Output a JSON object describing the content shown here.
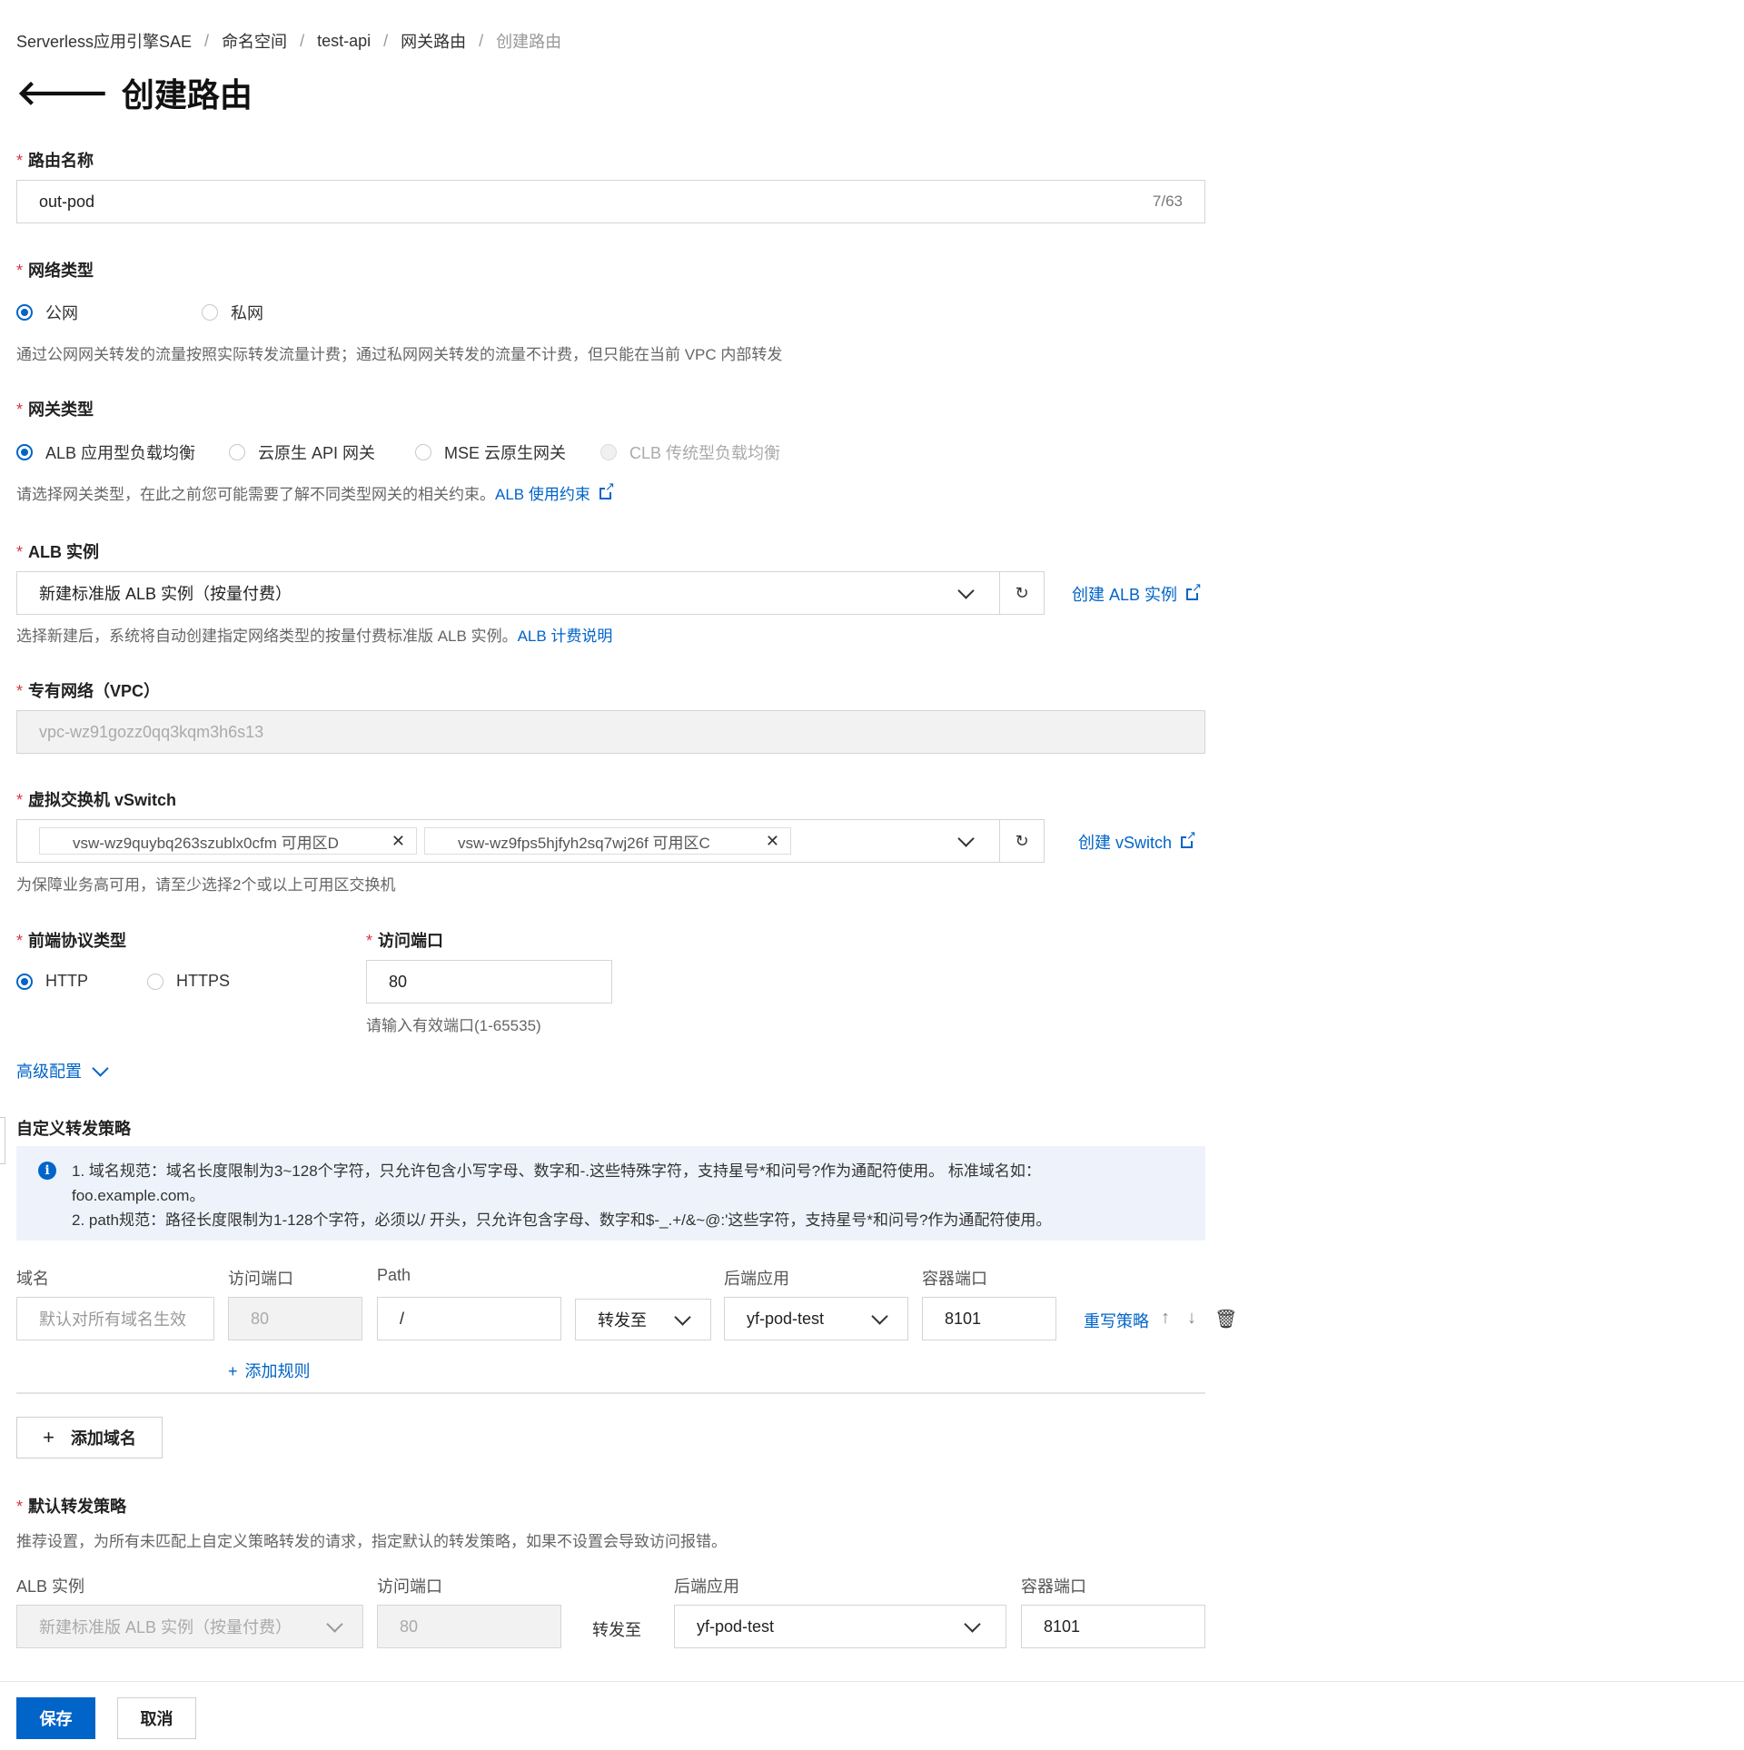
{
  "breadcrumb": [
    "Serverless应用引擎SAE",
    "命名空间",
    "test-api",
    "网关路由",
    "创建路由"
  ],
  "page_title": "创建路由",
  "route_name": {
    "label": "路由名称",
    "value": "out-pod",
    "counter": "7/63"
  },
  "network_type": {
    "label": "网络类型",
    "options": [
      "公网",
      "私网"
    ],
    "selected": "公网",
    "help": "通过公网网关转发的流量按照实际转发流量计费；通过私网网关转发的流量不计费，但只能在当前 VPC 内部转发"
  },
  "gateway_type": {
    "label": "网关类型",
    "options": [
      "ALB 应用型负载均衡",
      "云原生 API 网关",
      "MSE 云原生网关",
      "CLB 传统型负载均衡"
    ],
    "selected": "ALB 应用型负载均衡",
    "help": "请选择网关类型，在此之前您可能需要了解不同类型网关的相关约束。",
    "help_link": "ALB 使用约束"
  },
  "alb_instance": {
    "label": "ALB 实例",
    "value": "新建标准版 ALB 实例（按量付费）",
    "create_link": "创建 ALB 实例",
    "help": "选择新建后，系统将自动创建指定网络类型的按量付费标准版 ALB 实例。",
    "help_link": "ALB 计费说明"
  },
  "vpc": {
    "label": "专有网络（VPC）",
    "value": "vpc-wz91gozz0qq3kqm3h6s13"
  },
  "vswitch": {
    "label": "虚拟交换机 vSwitch",
    "tags": [
      "vsw-wz9quybq263szublx0cfm   可用区D",
      "vsw-wz9fps5hjfyh2sq7wj26f   可用区C"
    ],
    "create_link": "创建 vSwitch",
    "help": "为保障业务高可用，请至少选择2个或以上可用区交换机"
  },
  "frontend_protocol": {
    "label": "前端协议类型",
    "options": [
      "HTTP",
      "HTTPS"
    ],
    "selected": "HTTP"
  },
  "access_port": {
    "label": "访问端口",
    "value": "80",
    "help": "请输入有效端口(1-65535)"
  },
  "advanced": {
    "label": "高级配置"
  },
  "custom_policy": {
    "label": "自定义转发策略",
    "notice_line1": "1. 域名规范：域名长度限制为3~128个字符，只允许包含小写字母、数字和-.这些特殊字符，支持星号*和问号?作为通配符使用。 标准域名如：",
    "notice_line1b": "foo.example.com。",
    "notice_line2": "2. path规范：路径长度限制为1-128个字符，必须以/ 开头，只允许包含字母、数字和$-_.+/&~@:'这些字符，支持星号*和问号?作为通配符使用。",
    "columns": {
      "domain": "域名",
      "port": "访问端口",
      "path": "Path",
      "backend": "后端应用",
      "container_port": "容器端口"
    },
    "row": {
      "domain_placeholder": "默认对所有域名生效",
      "port": "80",
      "path": "/",
      "forward": "转发至",
      "backend": "yf-pod-test",
      "container_port": "8101",
      "rewrite": "重写策略"
    },
    "add_rule": "添加规则",
    "add_domain": "添加域名"
  },
  "default_policy": {
    "label": "默认转发策略",
    "help": "推荐设置，为所有未匹配上自定义策略转发的请求，指定默认的转发策略，如果不设置会导致访问报错。",
    "columns": {
      "alb": "ALB 实例",
      "port": "访问端口",
      "backend": "后端应用",
      "container_port": "容器端口"
    },
    "alb": "新建标准版 ALB 实例（按量付费）",
    "port": "80",
    "forward": "转发至",
    "backend": "yf-pod-test",
    "container_port": "8101"
  },
  "footer": {
    "save": "保存",
    "cancel": "取消"
  },
  "colors": {
    "accent": "#0064c8",
    "required": "#d9363e"
  }
}
